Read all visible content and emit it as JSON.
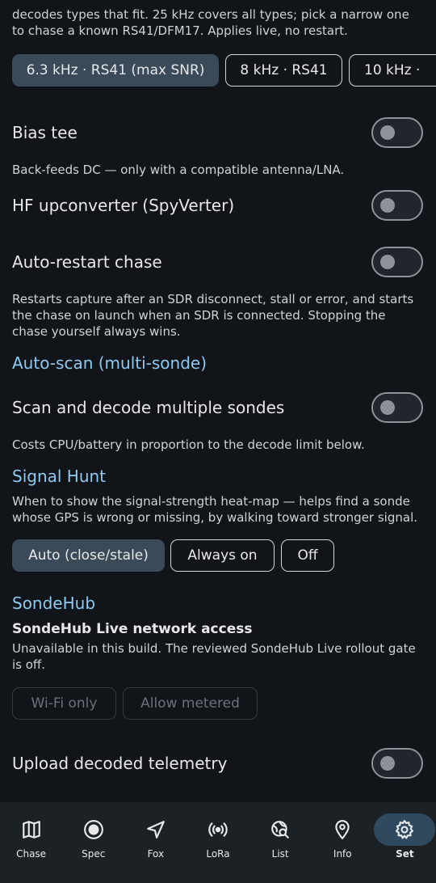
{
  "settings": {
    "bandwidth_desc": "decodes types that fit. 25 kHz covers all types; pick a narrow one to chase a known RS41/DFM17. Applies live, no restart.",
    "bandwidth_chips": [
      {
        "label": "6.3 kHz · RS41 (max SNR)",
        "selected": true
      },
      {
        "label": "8 kHz · RS41",
        "selected": false
      },
      {
        "label": "10 kHz ·",
        "selected": false
      }
    ],
    "bias_tee": {
      "label": "Bias tee",
      "desc": "Back-feeds DC — only with a compatible antenna/LNA.",
      "on": false
    },
    "hf_upconverter": {
      "label": "HF upconverter (SpyVerter)",
      "on": false
    },
    "auto_restart": {
      "label": "Auto-restart chase",
      "desc": "Restarts capture after an SDR disconnect, stall or error, and starts the chase on launch when an SDR is connected. Stopping the chase yourself always wins.",
      "on": false
    },
    "autoscan": {
      "title": "Auto-scan (multi-sonde)",
      "toggle_label": "Scan and decode multiple sondes",
      "desc": "Costs CPU/battery in proportion to the decode limit below.",
      "on": false
    },
    "signal_hunt": {
      "title": "Signal Hunt",
      "desc": "When to show the signal-strength heat-map — helps find a sonde whose GPS is wrong or missing, by walking toward stronger signal.",
      "options": [
        {
          "label": "Auto (close/stale)",
          "selected": true
        },
        {
          "label": "Always on",
          "selected": false
        },
        {
          "label": "Off",
          "selected": false
        }
      ]
    },
    "sondehub": {
      "title": "SondeHub",
      "access_label": "SondeHub Live network access",
      "access_desc": "Unavailable in this build. The reviewed SondeHub Live rollout gate is off.",
      "options": [
        {
          "label": "Wi-Fi only",
          "disabled": true
        },
        {
          "label": "Allow metered",
          "disabled": true
        }
      ],
      "upload_label": "Upload decoded telemetry",
      "upload_on": false
    }
  },
  "nav": {
    "items": [
      {
        "label": "Chase",
        "icon": "map-icon"
      },
      {
        "label": "Spec",
        "icon": "radio-button-icon"
      },
      {
        "label": "Fox",
        "icon": "navigation-arrow-icon"
      },
      {
        "label": "LoRa",
        "icon": "broadcast-icon"
      },
      {
        "label": "List",
        "icon": "globe-search-icon"
      },
      {
        "label": "Info",
        "icon": "location-pin-icon"
      },
      {
        "label": "Set",
        "icon": "gear-icon",
        "active": true
      }
    ]
  },
  "colors": {
    "background": "#11151a",
    "accent": "#8ec9f0",
    "selected_chip": "#3a4a58",
    "nav_background": "#1c2126",
    "nav_active_pill": "#2f4a5e"
  }
}
